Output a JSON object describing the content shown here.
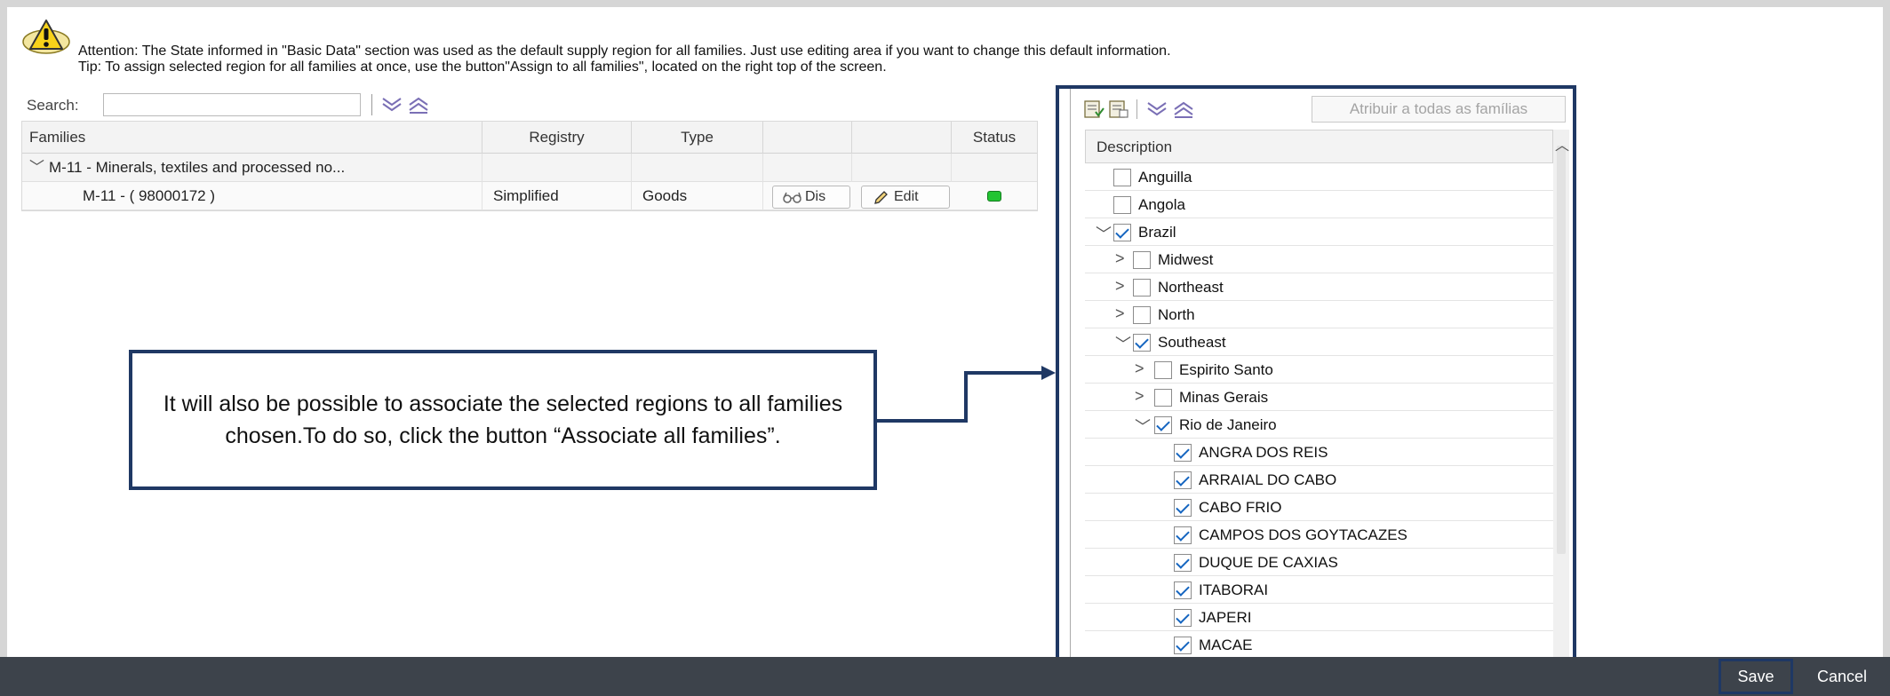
{
  "header": {
    "attention": "Attention: The State informed in \"Basic Data\" section was used as the default supply region for all families. Just use editing area if you want to change this default information.",
    "tip": "Tip: To assign selected region for all families at once, use the button\"Assign to all families\", located on the right top of the screen."
  },
  "search": {
    "label": "Search:",
    "value": ""
  },
  "table": {
    "columns": [
      "Families",
      "Registry",
      "Type",
      "",
      "",
      "Status"
    ],
    "group_row": "M-11 - Minerals, textiles and processed no...",
    "row": {
      "family": "M-11 -  ( 98000172 )",
      "registry": "Simplified",
      "type": "Goods",
      "display_label": "Dis",
      "edit_label": "Edit",
      "status_color": "#22c432"
    }
  },
  "callout": {
    "text": "It will also be possible to associate the selected regions to all families chosen.To do so, click the button “Associate all families”."
  },
  "regions": {
    "assign_button": "Atribuir a todas as famílias",
    "column": "Description",
    "nodes": [
      {
        "label": "Anguilla",
        "level": 1,
        "caret": "",
        "checked": false
      },
      {
        "label": "Angola",
        "level": 1,
        "caret": "",
        "checked": false
      },
      {
        "label": "Brazil",
        "level": 1,
        "caret": "down",
        "checked": true
      },
      {
        "label": "Midwest",
        "level": 2,
        "caret": "right",
        "checked": false
      },
      {
        "label": "Northeast",
        "level": 2,
        "caret": "right",
        "checked": false
      },
      {
        "label": "North",
        "level": 2,
        "caret": "right",
        "checked": false
      },
      {
        "label": "Southeast",
        "level": 2,
        "caret": "down",
        "checked": true
      },
      {
        "label": "Espirito Santo",
        "level": 3,
        "caret": "right",
        "checked": false
      },
      {
        "label": "Minas Gerais",
        "level": 3,
        "caret": "right",
        "checked": false
      },
      {
        "label": "Rio de Janeiro",
        "level": 3,
        "caret": "down",
        "checked": true
      },
      {
        "label": "ANGRA DOS REIS",
        "level": 4,
        "caret": "",
        "checked": true
      },
      {
        "label": "ARRAIAL DO CABO",
        "level": 4,
        "caret": "",
        "checked": true
      },
      {
        "label": "CABO FRIO",
        "level": 4,
        "caret": "",
        "checked": true
      },
      {
        "label": "CAMPOS DOS GOYTACAZES",
        "level": 4,
        "caret": "",
        "checked": true
      },
      {
        "label": "DUQUE DE CAXIAS",
        "level": 4,
        "caret": "",
        "checked": true
      },
      {
        "label": "ITABORAI",
        "level": 4,
        "caret": "",
        "checked": true
      },
      {
        "label": "JAPERI",
        "level": 4,
        "caret": "",
        "checked": true
      },
      {
        "label": "MACAE",
        "level": 4,
        "caret": "",
        "checked": true
      }
    ]
  },
  "footer": {
    "save": "Save",
    "cancel": "Cancel"
  },
  "colors": {
    "accent": "#1f3864",
    "bar": "#3d434b",
    "check": "#1565c0"
  }
}
